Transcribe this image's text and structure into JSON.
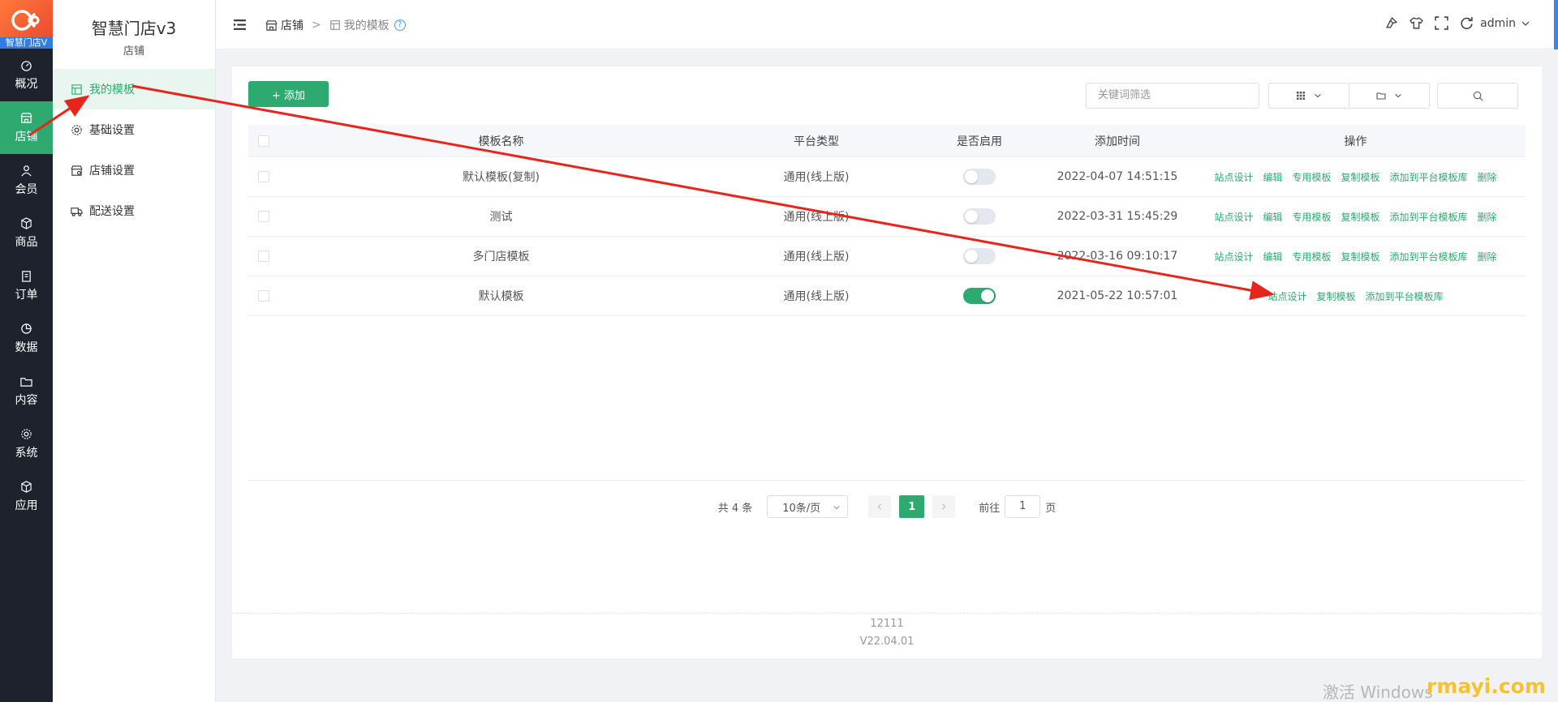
{
  "app": {
    "logo_text": "智慧门店V",
    "title": "智慧门店v3",
    "section": "店铺"
  },
  "rail": [
    {
      "label": "概况",
      "icon": "dashboard-icon"
    },
    {
      "label": "店铺",
      "icon": "store-icon",
      "active": true
    },
    {
      "label": "会员",
      "icon": "user-icon"
    },
    {
      "label": "商品",
      "icon": "box-icon"
    },
    {
      "label": "订单",
      "icon": "clipboard-icon"
    },
    {
      "label": "数据",
      "icon": "pie-icon"
    },
    {
      "label": "内容",
      "icon": "folder-icon"
    },
    {
      "label": "系统",
      "icon": "gear-icon"
    },
    {
      "label": "应用",
      "icon": "cube-icon"
    }
  ],
  "side": [
    {
      "label": "我的模板",
      "icon": "template-icon",
      "active": true
    },
    {
      "label": "基础设置",
      "icon": "gear-icon"
    },
    {
      "label": "店铺设置",
      "icon": "shop-settings-icon"
    },
    {
      "label": "配送设置",
      "icon": "truck-icon"
    }
  ],
  "breadcrumb": {
    "root": "店铺",
    "sep": ">",
    "current": "我的模板",
    "help": "?"
  },
  "user": {
    "name": "admin"
  },
  "toolbar": {
    "add_label": "+ 添加",
    "filter_placeholder": "关键词筛选"
  },
  "table": {
    "headers": [
      "模板名称",
      "平台类型",
      "是否启用",
      "添加时间",
      "操作"
    ],
    "rows": [
      {
        "name": "默认模板(复制)",
        "platform": "通用(线上版)",
        "enabled": false,
        "time": "2022-04-07 14:51:15",
        "ops": [
          "站点设计",
          "编辑",
          "专用模板",
          "复制模板",
          "添加到平台模板库",
          "删除"
        ]
      },
      {
        "name": "测试",
        "platform": "通用(线上版)",
        "enabled": false,
        "time": "2022-03-31 15:45:29",
        "ops": [
          "站点设计",
          "编辑",
          "专用模板",
          "复制模板",
          "添加到平台模板库",
          "删除"
        ]
      },
      {
        "name": "多门店模板",
        "platform": "通用(线上版)",
        "enabled": false,
        "time": "2022-03-16 09:10:17",
        "ops": [
          "站点设计",
          "编辑",
          "专用模板",
          "复制模板",
          "添加到平台模板库",
          "删除"
        ]
      },
      {
        "name": "默认模板",
        "platform": "通用(线上版)",
        "enabled": true,
        "time": "2021-05-22 10:57:01",
        "ops": [
          "站点设计",
          "复制模板",
          "添加到平台模板库"
        ]
      }
    ]
  },
  "pager": {
    "total": "共 4 条",
    "page_size": "10条/页",
    "current": "1",
    "goto_prefix": "前往",
    "goto_value": "1",
    "goto_suffix": "页"
  },
  "footer": {
    "line1": "12111",
    "line2": "V22.04.01"
  },
  "overlay": {
    "windows_text": "激活 Windows",
    "watermark": "rmayi.com"
  },
  "colors": {
    "accent": "#2eaa70",
    "arrow": "#e8251c",
    "rail_bg": "#1e222d"
  }
}
